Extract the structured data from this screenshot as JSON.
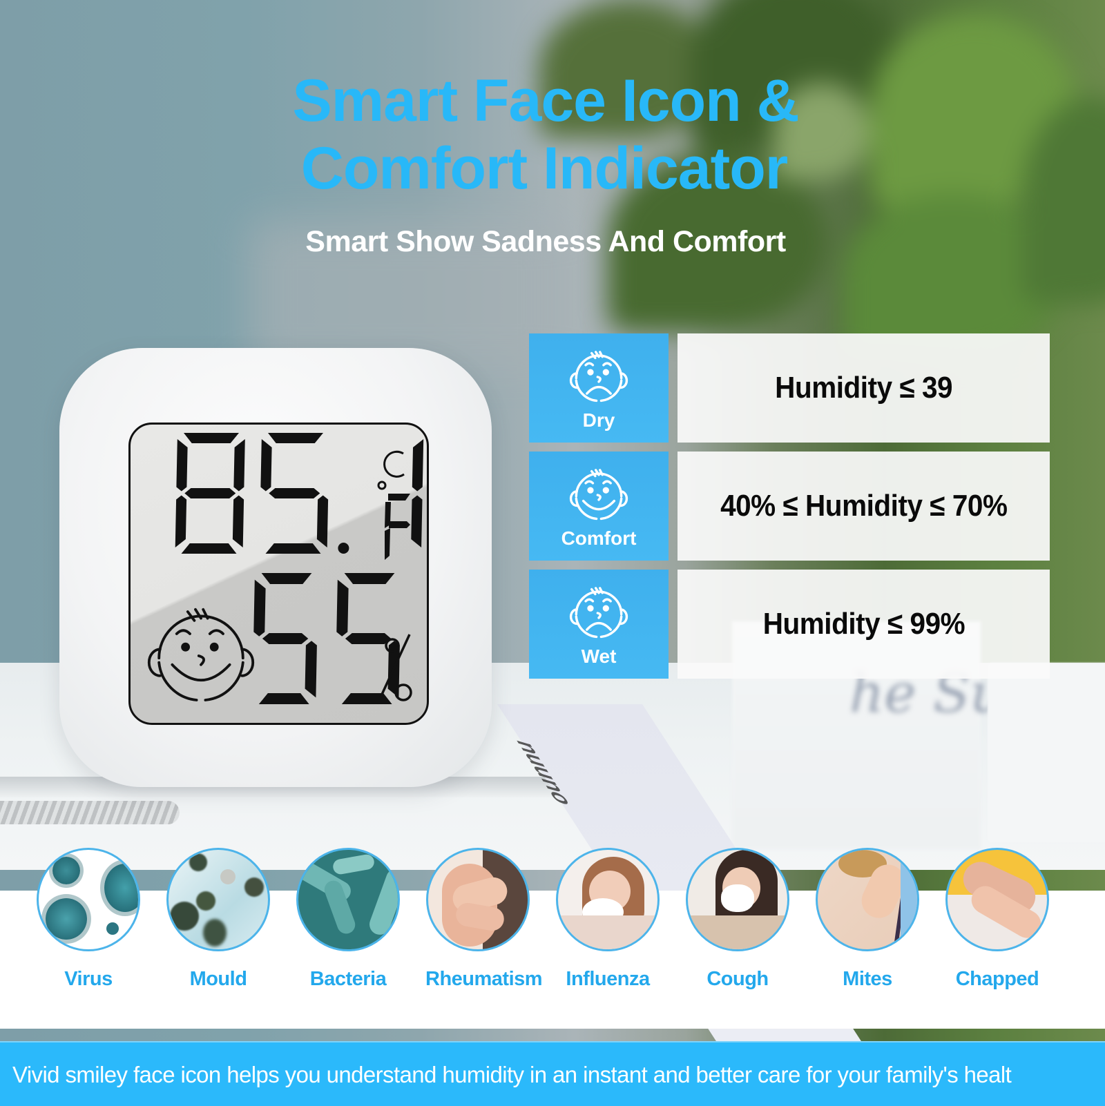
{
  "header": {
    "title_line1": "Smart Face Icon &",
    "title_line2": "Comfort Indicator",
    "subtitle": "Smart Show Sadness And Comfort"
  },
  "device": {
    "temperature": "85.1",
    "temperature_unit": "°F",
    "unit_options": [
      "°C",
      "°F"
    ],
    "humidity": "55",
    "humidity_unit": "%",
    "face_state": "comfort",
    "brand_strip": "nuuno"
  },
  "comfort_levels": [
    {
      "face": "sad-face-icon",
      "label": "Dry",
      "range": "Humidity ≤ 39"
    },
    {
      "face": "smile-face-icon",
      "label": "Comfort",
      "range": "40% ≤ Humidity ≤ 70%"
    },
    {
      "face": "sad-face-icon",
      "label": "Wet",
      "range": "Humidity ≤ 99%"
    }
  ],
  "risks": [
    {
      "label": "Virus",
      "image": "virus-particles"
    },
    {
      "label": "Mould",
      "image": "mould-spores"
    },
    {
      "label": "Bacteria",
      "image": "bacteria-rods"
    },
    {
      "label": "Rheumatism",
      "image": "hands-on-knee"
    },
    {
      "label": "Influenza",
      "image": "girl-with-tissue"
    },
    {
      "label": "Cough",
      "image": "woman-in-mask"
    },
    {
      "label": "Mites",
      "image": "scratching-back"
    },
    {
      "label": "Chapped",
      "image": "dry-hands"
    }
  ],
  "banner": {
    "text": "Vivid smiley face icon helps you understand humidity in an instant and better care for your family's healt"
  },
  "colors": {
    "accent_blue": "#28b8f8",
    "icon_cell_blue": "#43b5f0",
    "banner_blue": "#2bb9fb",
    "risk_label_blue": "#23a8ec"
  }
}
